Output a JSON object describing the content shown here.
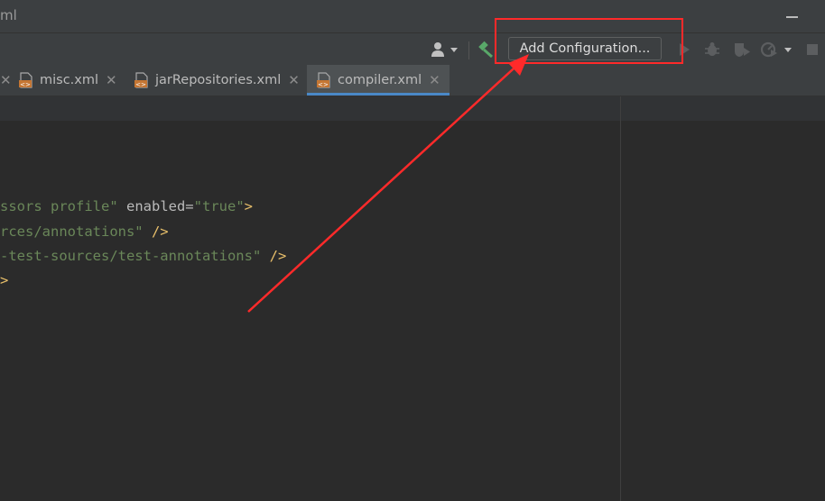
{
  "window": {
    "title_fragment": "ml"
  },
  "toolbar": {
    "add_configuration_label": "Add Configuration..."
  },
  "tabs": [
    {
      "label": "misc.xml",
      "close": "✕",
      "active": false
    },
    {
      "label": "jarRepositories.xml",
      "close": "✕",
      "active": false
    },
    {
      "label": "compiler.xml",
      "close": "✕",
      "active": true
    }
  ],
  "editor": {
    "line1": {
      "str": "ssors profile\"",
      "attr": " enabled=",
      "val": "\"true\"",
      "tag": ">"
    },
    "line2": {
      "str": "rces/annotations\"",
      "tag": " />"
    },
    "line3": {
      "str": "-test-sources/test-annotations\"",
      "tag": " />"
    },
    "line4": {
      "tag": ">"
    }
  },
  "colors": {
    "annotation_red": "#ff2a2a",
    "hammer_green": "#59a869",
    "xml_icon_orange": "#c57633",
    "active_tab_underline": "#4a88c7"
  }
}
